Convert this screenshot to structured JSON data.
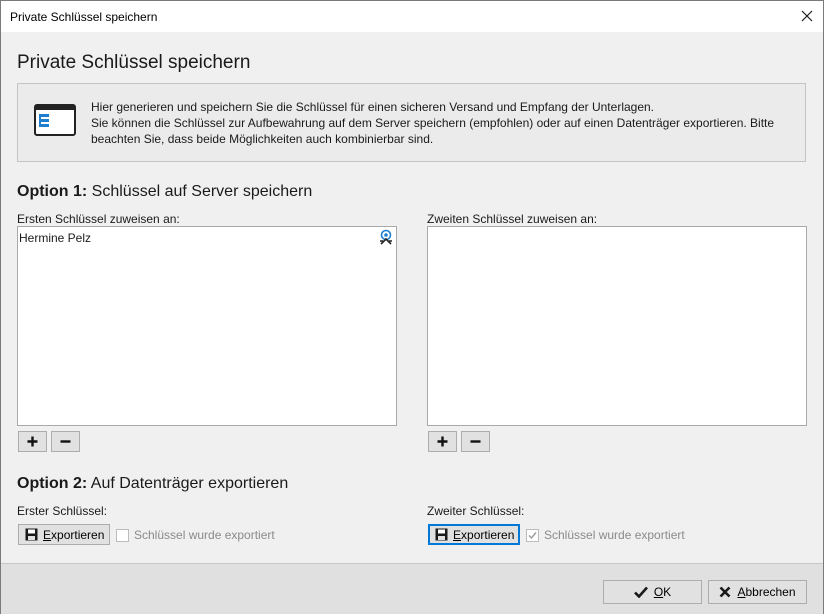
{
  "window": {
    "title": "Private Schlüssel speichern"
  },
  "page": {
    "heading": "Private Schlüssel speichern"
  },
  "info": {
    "icon": "id-card-icon",
    "lines": [
      "Hier generieren und speichern Sie die Schlüssel für einen sicheren Versand und Empfang der Unterlagen.",
      "Sie können die Schlüssel zur Aufbewahrung auf dem Server speichern (empfohlen) oder auf einen Datenträger exportieren. Bitte beachten Sie, dass beide Möglichkeiten auch kombinierbar sind."
    ]
  },
  "option1": {
    "bold": "Option 1:",
    "title": " Schlüssel auf Server speichern",
    "first_label": "Ersten Schlüssel zuweisen an:",
    "second_label": "Zweiten Schlüssel zuweisen an:",
    "first_list": [
      {
        "name": "Hermine Pelz",
        "icon": "key-user-icon"
      }
    ],
    "second_list": [],
    "add_icon": "plus-icon",
    "remove_icon": "minus-icon"
  },
  "option2": {
    "bold": "Option 2:",
    "title": " Auf Datenträger exportieren",
    "first_label": "Erster Schlüssel:",
    "second_label": "Zweiter Schlüssel:",
    "export_mnemonic": "E",
    "export_rest": "xportieren",
    "export_checkbox_label": "Schlüssel wurde exportiert",
    "first_exported": false,
    "second_exported": true
  },
  "footer": {
    "ok_mnemonic": "O",
    "ok_rest": "K",
    "cancel_mnemonic": "A",
    "cancel_rest": "bbrechen"
  },
  "colors": {
    "accent": "#0078d7",
    "icon_blue": "#1e7fd1"
  }
}
